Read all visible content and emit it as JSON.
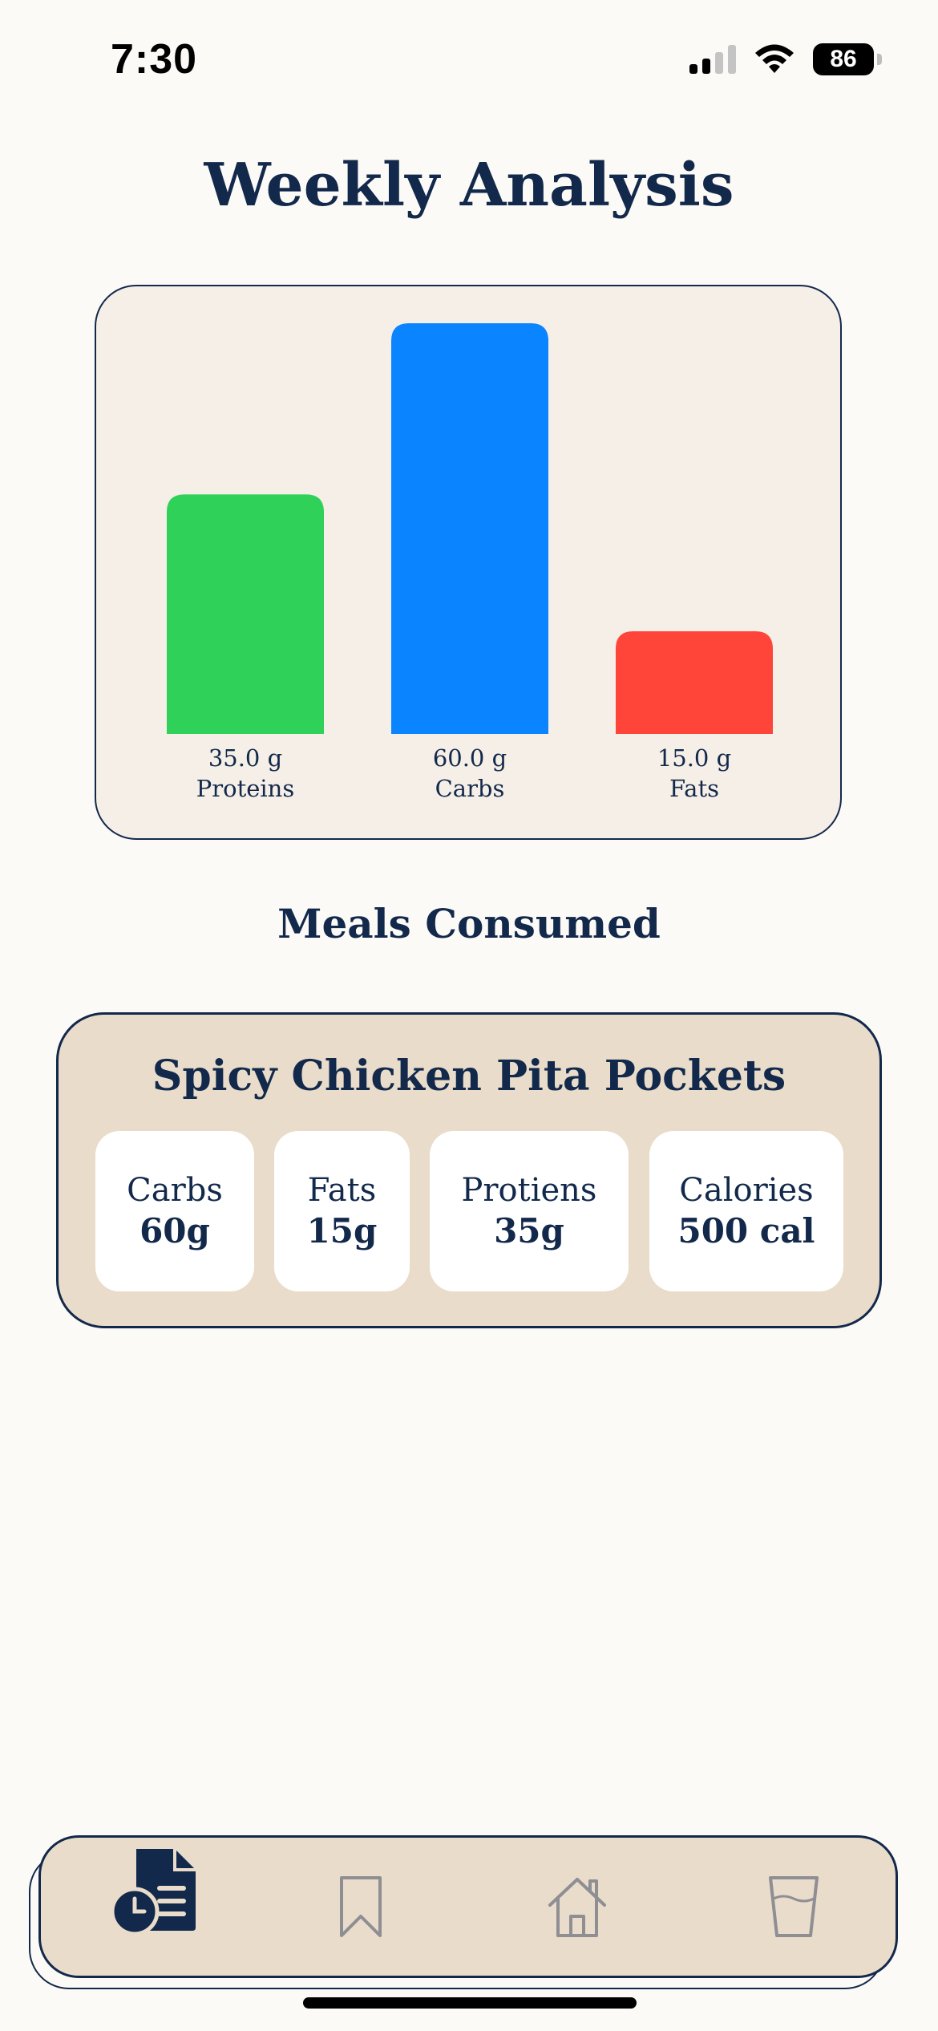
{
  "status_bar": {
    "time": "7:30",
    "battery": "86",
    "icons": [
      "cellular-signal-icon",
      "wifi-icon",
      "battery-icon"
    ]
  },
  "page": {
    "title": "Weekly Analysis"
  },
  "chart_data": {
    "type": "bar",
    "categories": [
      "Proteins",
      "Carbs",
      "Fats"
    ],
    "values": [
      35.0,
      60.0,
      15.0
    ],
    "value_labels": [
      "35.0 g",
      "60.0 g",
      "15.0 g"
    ],
    "unit": "g",
    "colors": [
      "#30d158",
      "#0a84ff",
      "#ff453a"
    ],
    "ylim": [
      0,
      60
    ],
    "grid": false,
    "title": "",
    "xlabel": "",
    "ylabel": ""
  },
  "meals": {
    "section_title": "Meals Consumed",
    "items": [
      {
        "name": "Spicy Chicken Pita Pockets",
        "nutrients": [
          {
            "label": "Carbs",
            "value": "60g"
          },
          {
            "label": "Fats",
            "value": "15g"
          },
          {
            "label": "Protiens",
            "value": "35g"
          },
          {
            "label": "Calories",
            "value": "500 cal"
          }
        ]
      }
    ]
  },
  "tab_bar": {
    "items": [
      {
        "icon": "meal-history-icon",
        "active": true
      },
      {
        "icon": "bookmark-icon",
        "active": false
      },
      {
        "icon": "home-icon",
        "active": false
      },
      {
        "icon": "water-glass-icon",
        "active": false
      }
    ]
  },
  "colors": {
    "primary": "#13294b",
    "background": "#fcfaf7",
    "card_beige": "#e9dcca",
    "chart_bg": "#f5efe7",
    "inactive_icon": "#8e8e93"
  }
}
